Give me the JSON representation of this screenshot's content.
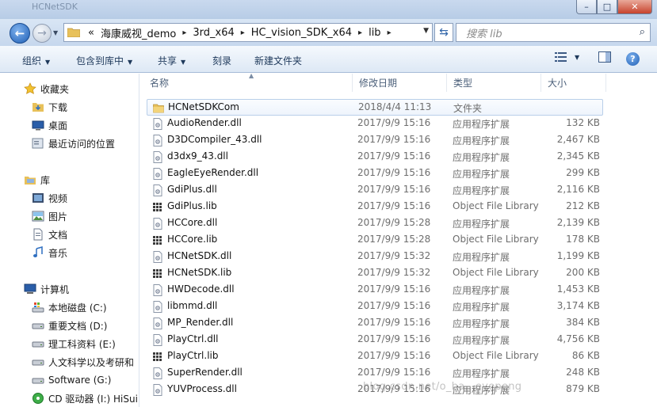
{
  "titlebar": {
    "ghost_text": "HCNetSDK"
  },
  "address": {
    "overflow": "«",
    "crumbs": [
      "海康威视_demo",
      "3rd_x64",
      "HC_vision_SDK_x64",
      "lib"
    ],
    "search_placeholder": "搜索 lib"
  },
  "toolbar": {
    "organize": "组织",
    "include_in_library": "包含到库中",
    "share": "共享",
    "burn": "刻录",
    "new_folder": "新建文件夹"
  },
  "sidebar": {
    "favorites": {
      "label": "收藏夹",
      "items": [
        "下载",
        "桌面",
        "最近访问的位置"
      ]
    },
    "libraries": {
      "label": "库",
      "items": [
        "视频",
        "图片",
        "文档",
        "音乐"
      ]
    },
    "computer": {
      "label": "计算机",
      "items": [
        "本地磁盘 (C:)",
        "重要文档 (D:)",
        "理工科资料 (E:)",
        "人文科学以及考研和",
        "Software (G:)",
        "CD 驱动器 (I:) HiSui"
      ]
    }
  },
  "columns": {
    "name": "名称",
    "date": "修改日期",
    "type": "类型",
    "size": "大小"
  },
  "files": [
    {
      "name": "HCNetSDKCom",
      "date": "2018/4/4 11:13",
      "type": "文件夹",
      "size": "",
      "kind": "folder"
    },
    {
      "name": "AudioRender.dll",
      "date": "2017/9/9 15:16",
      "type": "应用程序扩展",
      "size": "132 KB",
      "kind": "dll"
    },
    {
      "name": "D3DCompiler_43.dll",
      "date": "2017/9/9 15:16",
      "type": "应用程序扩展",
      "size": "2,467 KB",
      "kind": "dll"
    },
    {
      "name": "d3dx9_43.dll",
      "date": "2017/9/9 15:16",
      "type": "应用程序扩展",
      "size": "2,345 KB",
      "kind": "dll"
    },
    {
      "name": "EagleEyeRender.dll",
      "date": "2017/9/9 15:16",
      "type": "应用程序扩展",
      "size": "299 KB",
      "kind": "dll"
    },
    {
      "name": "GdiPlus.dll",
      "date": "2017/9/9 15:16",
      "type": "应用程序扩展",
      "size": "2,116 KB",
      "kind": "dll"
    },
    {
      "name": "GdiPlus.lib",
      "date": "2017/9/9 15:16",
      "type": "Object File Library",
      "size": "212 KB",
      "kind": "lib"
    },
    {
      "name": "HCCore.dll",
      "date": "2017/9/9 15:28",
      "type": "应用程序扩展",
      "size": "2,139 KB",
      "kind": "dll"
    },
    {
      "name": "HCCore.lib",
      "date": "2017/9/9 15:28",
      "type": "Object File Library",
      "size": "178 KB",
      "kind": "lib"
    },
    {
      "name": "HCNetSDK.dll",
      "date": "2017/9/9 15:32",
      "type": "应用程序扩展",
      "size": "1,199 KB",
      "kind": "dll"
    },
    {
      "name": "HCNetSDK.lib",
      "date": "2017/9/9 15:32",
      "type": "Object File Library",
      "size": "200 KB",
      "kind": "lib"
    },
    {
      "name": "HWDecode.dll",
      "date": "2017/9/9 15:16",
      "type": "应用程序扩展",
      "size": "1,453 KB",
      "kind": "dll"
    },
    {
      "name": "libmmd.dll",
      "date": "2017/9/9 15:16",
      "type": "应用程序扩展",
      "size": "3,174 KB",
      "kind": "dll"
    },
    {
      "name": "MP_Render.dll",
      "date": "2017/9/9 15:16",
      "type": "应用程序扩展",
      "size": "384 KB",
      "kind": "dll"
    },
    {
      "name": "PlayCtrl.dll",
      "date": "2017/9/9 15:16",
      "type": "应用程序扩展",
      "size": "4,756 KB",
      "kind": "dll"
    },
    {
      "name": "PlayCtrl.lib",
      "date": "2017/9/9 15:16",
      "type": "Object File Library",
      "size": "86 KB",
      "kind": "lib"
    },
    {
      "name": "SuperRender.dll",
      "date": "2017/9/9 15:16",
      "type": "应用程序扩展",
      "size": "248 KB",
      "kind": "dll"
    },
    {
      "name": "YUVProcess.dll",
      "date": "2017/9/9 15:16",
      "type": "应用程序扩展",
      "size": "879 KB",
      "kind": "dll"
    }
  ],
  "watermark": "blog.csdn.net/o_ha...eyepeng",
  "colors": {
    "accent": "#1f5fb5",
    "selection_border": "#b9cfe9",
    "folder": "#e8c15a"
  }
}
